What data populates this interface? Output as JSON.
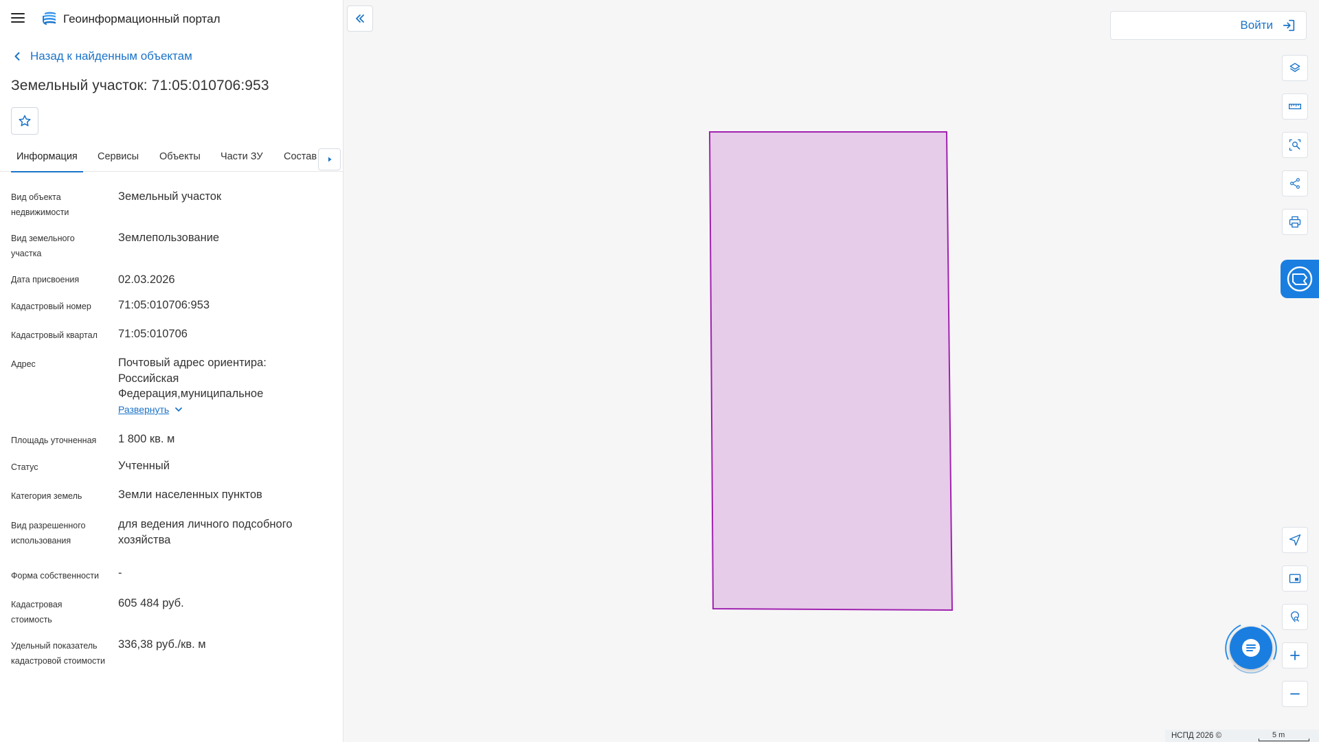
{
  "app": {
    "title": "Геоинформационный портал"
  },
  "nav": {
    "back_label": "Назад к найденным объектам"
  },
  "object": {
    "title": "Земельный участок: 71:05:010706:953"
  },
  "tabs": [
    {
      "label": "Информация",
      "active": true
    },
    {
      "label": "Сервисы",
      "active": false
    },
    {
      "label": "Объекты",
      "active": false
    },
    {
      "label": "Части ЗУ",
      "active": false
    },
    {
      "label": "Состав",
      "active": false
    }
  ],
  "properties": [
    {
      "label": "Вид объекта недвижимости",
      "value": "Земельный участок"
    },
    {
      "label": "Вид земельного участка",
      "value": "Землепользование"
    },
    {
      "label": "Дата присвоения",
      "value": "02.03.2026"
    },
    {
      "label": "Кадастровый номер",
      "value": "71:05:010706:953"
    },
    {
      "label": "Кадастровый квартал",
      "value": "71:05:010706"
    },
    {
      "label": "Адрес",
      "value": "Почтовый адрес ориентира: Российская Федерация,муниципальное",
      "expand_label": "Развернуть"
    },
    {
      "label": "Площадь уточненная",
      "value": "1 800 кв. м"
    },
    {
      "label": "Статус",
      "value": "Учтенный"
    },
    {
      "label": "Категория земель",
      "value": "Земли населенных пунктов"
    },
    {
      "label": "Вид разрешенного использования",
      "value": "для ведения личного подсобного хозяйства"
    },
    {
      "label": "Форма собственности",
      "value": "-"
    },
    {
      "label": "Кадастровая стоимость",
      "value": "605 484 руб."
    },
    {
      "label": "Удельный показатель кадастровой стоимости",
      "value": "336,38 руб./кв. м"
    }
  ],
  "map": {
    "login_label": "Войти",
    "attribution": "НСПД 2026 ©",
    "scale_label": "5 m",
    "parcel_fill": "#e6cce8",
    "parcel_stroke": "#a020b0",
    "accent": "#1a73c8"
  },
  "icons": {
    "menu": "hamburger-icon",
    "logo": "portal-logo-icon",
    "back": "chevron-left-icon",
    "favorite": "star-icon",
    "tab_next": "caret-right-icon",
    "expand": "chevron-down-icon",
    "collapse": "double-chevron-left-icon",
    "login": "sign-in-icon",
    "layers": "layers-icon",
    "ruler": "ruler-icon",
    "select_area": "area-select-icon",
    "share": "share-icon",
    "print": "printer-icon",
    "gosuslugi": "gosuslugi-icon",
    "locate": "navigation-arrow-icon",
    "minimap": "minimap-icon",
    "geo_search": "location-search-icon",
    "zoom_in": "plus-icon",
    "zoom_out": "minus-icon",
    "chat": "chat-icon"
  }
}
